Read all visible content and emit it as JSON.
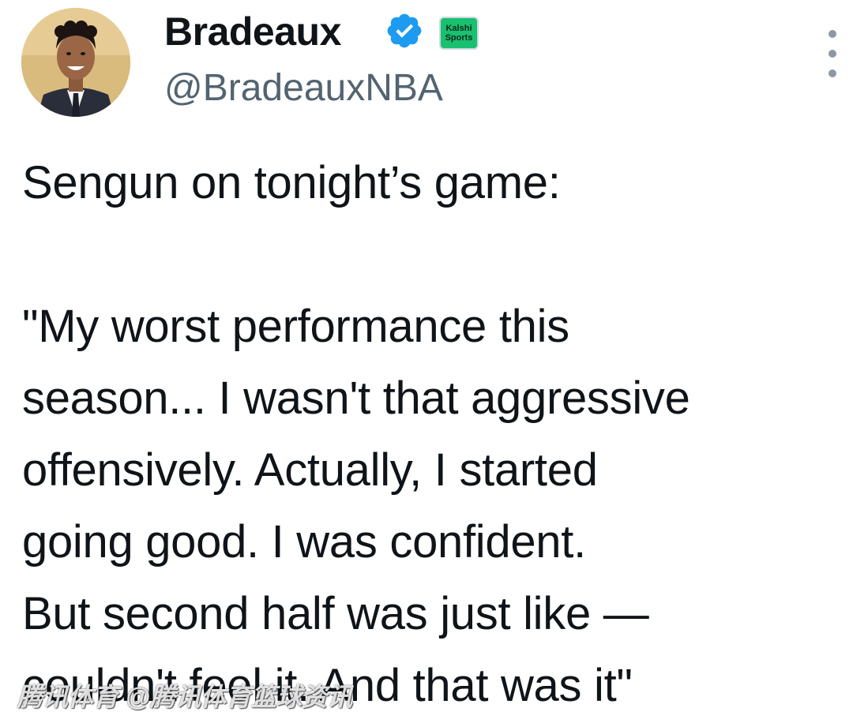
{
  "author": {
    "display_name": "Bradeaux",
    "handle": "@BradeauxNBA",
    "verified_icon": "verified-badge-icon",
    "verified_color": "#1d9bf0",
    "sponsor_badge": {
      "line1": "Kalshi",
      "line2": "Sports",
      "color": "#18c070"
    }
  },
  "menu": {
    "icon": "more-vertical-icon"
  },
  "tweet": {
    "intro": "Sengun on tonight’s game:",
    "quote": "\"My worst performance this\nseason... I wasn't that aggressive\noffensively. Actually, I started\ngoing good. I was confident.\nBut second half was just like —\ncouldn't feel it. And that was it\""
  },
  "watermark": {
    "text": "腾讯体育 @腾讯体育篮球资讯"
  }
}
